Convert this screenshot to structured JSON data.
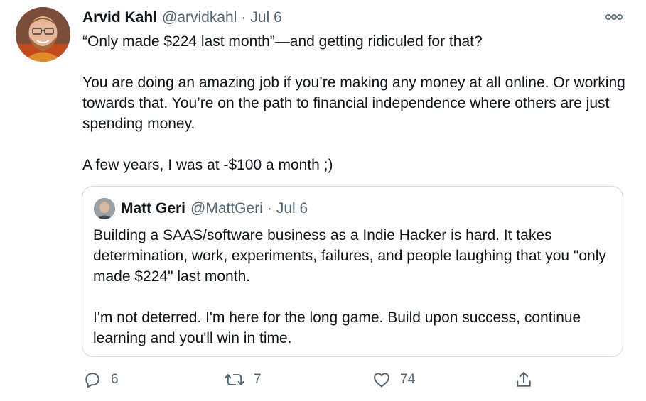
{
  "tweet": {
    "author_name": "Arvid Kahl",
    "author_handle": "@arvidkahl",
    "separator": "·",
    "date": "Jul 6",
    "paragraphs": [
      "“Only made $224 last month”—and getting ridiculed for that?",
      "You are doing an amazing job if you’re making any money at all online. Or working towards that. You’re on the path to financial independence where others are just spending money.",
      "A few years, I was at -$100 a month ;)"
    ]
  },
  "quote": {
    "author_name": "Matt Geri",
    "author_handle": "@MattGeri",
    "separator": "·",
    "date": "Jul 6",
    "paragraphs": [
      "Building a SAAS/software business as a Indie Hacker is hard. It takes determination, work, experiments, failures, and people laughing that you \"only made $224\" last month.",
      "I'm not deterred. I'm here for the long game. Build upon success, continue learning and you'll win in time."
    ]
  },
  "actions": {
    "reply_count": "6",
    "retweet_count": "7",
    "like_count": "74"
  },
  "icons": {
    "more": "more-horizontal-icon",
    "reply": "reply-icon",
    "retweet": "retweet-icon",
    "like": "heart-icon",
    "share": "share-icon"
  },
  "colors": {
    "text": "#0f1419",
    "secondary": "#536471",
    "border": "#cfd9de"
  }
}
